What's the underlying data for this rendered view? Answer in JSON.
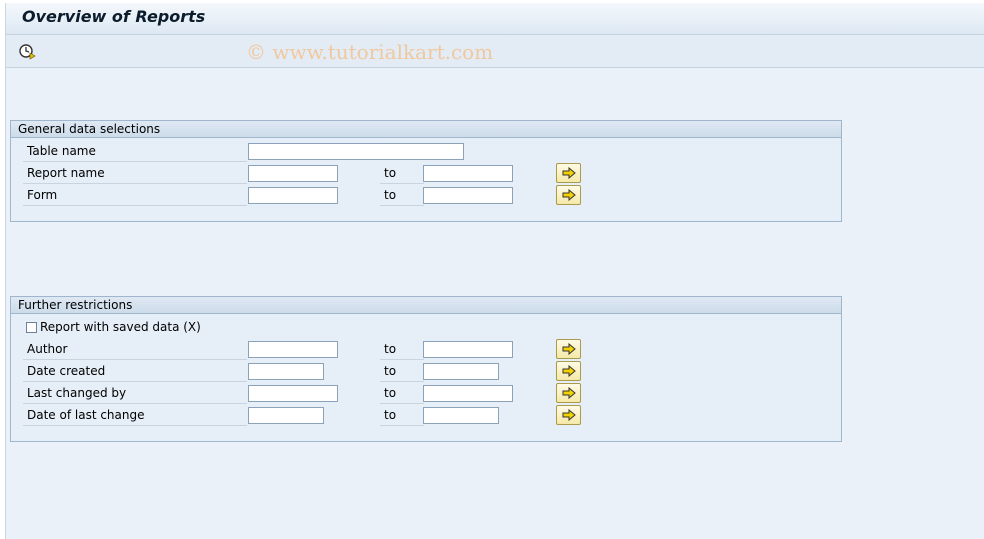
{
  "window": {
    "title": "Overview of Reports"
  },
  "toolbar": {
    "watermark": "© www.tutorialkart.com",
    "execute_icon": "clock-execute-icon"
  },
  "general": {
    "header": "General data selections",
    "table_name": {
      "label": "Table name",
      "value": ""
    },
    "report_name": {
      "label": "Report name",
      "to": "to",
      "from_value": "",
      "to_value": ""
    },
    "form": {
      "label": "Form",
      "to": "to",
      "from_value": "",
      "to_value": ""
    }
  },
  "further": {
    "header": "Further restrictions",
    "saved_data": {
      "label": "Report with saved data (X)",
      "checked": false
    },
    "author": {
      "label": "Author",
      "to": "to",
      "from_value": "",
      "to_value": ""
    },
    "date_created": {
      "label": "Date created",
      "to": "to",
      "from_value": "",
      "to_value": ""
    },
    "last_changed_by": {
      "label": "Last changed by",
      "to": "to",
      "from_value": "",
      "to_value": ""
    },
    "date_last_change": {
      "label": "Date of last change",
      "to": "to",
      "from_value": "",
      "to_value": ""
    }
  },
  "colors": {
    "background": "#eaf1f8",
    "button": "#f5e9a8",
    "arrow": "#f2d200"
  },
  "icons": {
    "multiple_selection": "arrow-right-icon"
  }
}
